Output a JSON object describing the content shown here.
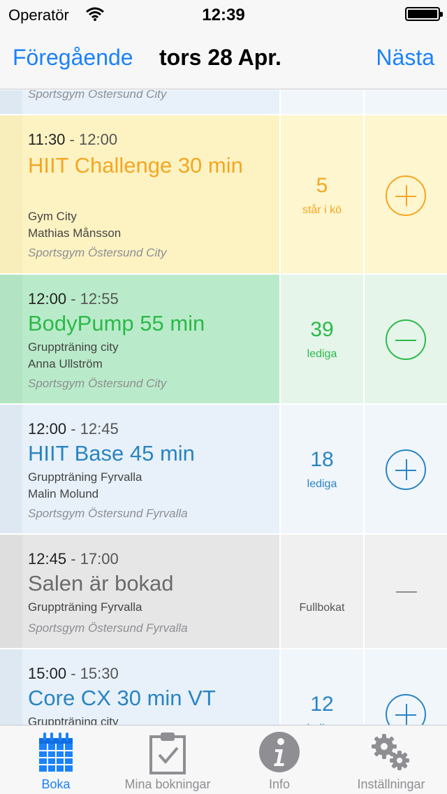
{
  "status_bar": {
    "carrier": "Operatör",
    "time": "12:39"
  },
  "nav": {
    "prev": "Föregående",
    "title": "tors 28 Apr.",
    "next": "Nästa"
  },
  "colors": {
    "accent": "#1a82fb",
    "orange": "#f5a623",
    "green": "#2cb94a",
    "blue": "#2a84c2",
    "gray": "#8e8e93"
  },
  "rows": [
    {
      "venue": "Sportsgym Östersund City"
    },
    {
      "start": "11:30",
      "sep": "-",
      "end": "12:00",
      "title": "HIIT Challenge 30 min",
      "room": "Gym City",
      "instructor": "Mathias Månsson",
      "venue": "Sportsgym Östersund City",
      "count": "5",
      "count_label": "står i kö",
      "action": "plus-icon"
    },
    {
      "start": "12:00",
      "sep": "-",
      "end": "12:55",
      "title": "BodyPump 55 min",
      "room": "Gruppträning city",
      "instructor": "Anna Ullström",
      "venue": "Sportsgym Östersund City",
      "count": "39",
      "count_label": "lediga",
      "action": "minus-icon"
    },
    {
      "start": "12:00",
      "sep": "-",
      "end": "12:45",
      "title": "HIIT Base 45 min",
      "room": "Gruppträning Fyrvalla",
      "instructor": "Malin Molund",
      "venue": "Sportsgym Östersund Fyrvalla",
      "count": "18",
      "count_label": "lediga",
      "action": "plus-icon"
    },
    {
      "start": "12:45",
      "sep": "-",
      "end": "17:00",
      "title": "Salen är bokad",
      "room": "Gruppträning Fyrvalla",
      "venue": "Sportsgym Östersund Fyrvalla",
      "count_label": "Fullbokat",
      "action": "dash-icon"
    },
    {
      "start": "15:00",
      "sep": "-",
      "end": "15:30",
      "title": "Core CX 30 min VT",
      "room": "Gruppträning city",
      "count": "12",
      "count_label": "lediga",
      "action": "plus-icon"
    }
  ],
  "tabs": [
    {
      "label": "Boka",
      "icon": "calendar-icon",
      "active": true
    },
    {
      "label": "Mina bokningar",
      "icon": "clipboard-check-icon",
      "active": false
    },
    {
      "label": "Info",
      "icon": "info-icon",
      "active": false
    },
    {
      "label": "Inställningar",
      "icon": "gears-icon",
      "active": false
    }
  ]
}
